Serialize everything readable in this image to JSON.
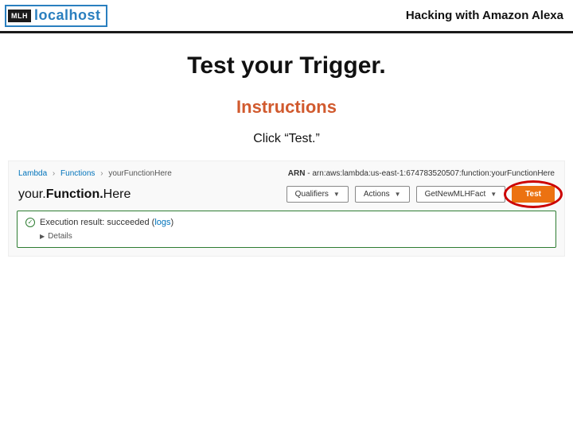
{
  "header": {
    "logo_badge": "MLH",
    "logo_text": "localhost",
    "title": "Hacking with Amazon Alexa"
  },
  "content": {
    "heading": "Test your Trigger.",
    "subheading": "Instructions",
    "instruction": "Click “Test.”"
  },
  "lambda": {
    "crumbs": {
      "c1": "Lambda",
      "c2": "Functions",
      "c3": "yourFunctionHere"
    },
    "arn_label": "ARN",
    "arn_value": "arn:aws:lambda:us-east-1:674783520507:function:yourFunctionHere",
    "fn_name_light1": "your.",
    "fn_name_bold": "Function.",
    "fn_name_light2": "Here",
    "qualifiers_label": "Qualifiers",
    "actions_label": "Actions",
    "event_label": "GetNewMLHFact",
    "test_label": "Test",
    "result_prefix": "Execution result: ",
    "result_status": "succeeded",
    "logs_label": "logs",
    "details_label": "Details"
  }
}
